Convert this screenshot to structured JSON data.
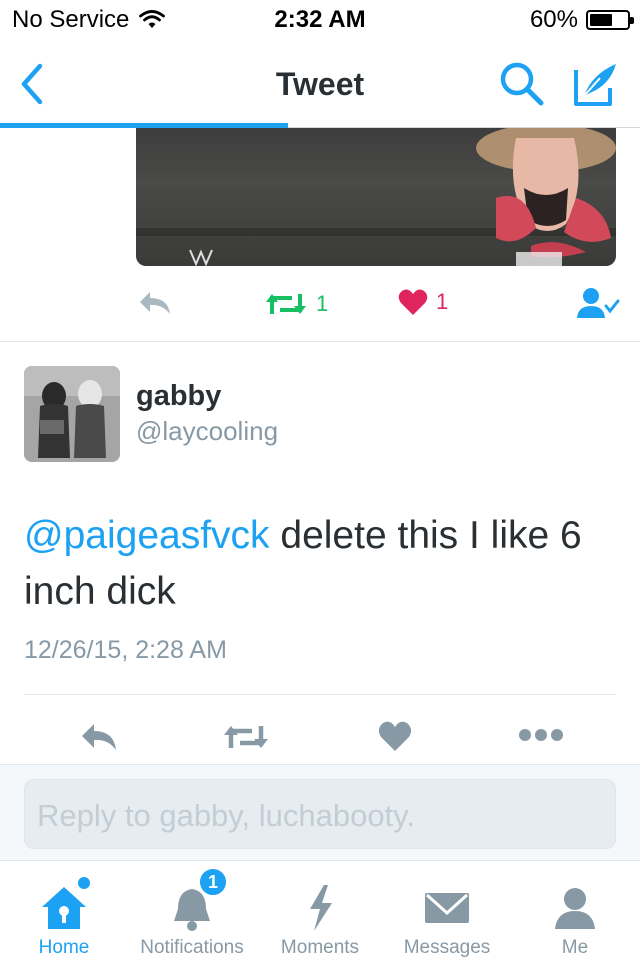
{
  "status_bar": {
    "carrier": "No Service",
    "time": "2:32 AM",
    "battery_percent": "60%",
    "battery_level": 0.6
  },
  "nav": {
    "title": "Tweet",
    "back_icon": "chevron-left-icon",
    "search_icon": "search-icon",
    "compose_icon": "compose-icon",
    "load_progress": 0.45
  },
  "parent_tweet": {
    "media_alt": "",
    "actions": {
      "retweet_count": "1",
      "like_count": "1"
    }
  },
  "tweet": {
    "name": "gabby",
    "handle": "@laycooling",
    "mention": "@paigeasfvck",
    "text": " delete this I like 6 inch dick",
    "timestamp": "12/26/15, 2:28 AM"
  },
  "reply": {
    "placeholder": "Reply to gabby, luchabooty."
  },
  "tabs": [
    {
      "label": "Home",
      "icon": "home-icon",
      "active": true
    },
    {
      "label": "Notifications",
      "icon": "bell-icon",
      "badge": "1"
    },
    {
      "label": "Moments",
      "icon": "lightning-icon"
    },
    {
      "label": "Messages",
      "icon": "envelope-icon"
    },
    {
      "label": "Me",
      "icon": "person-icon"
    }
  ],
  "colors": {
    "accent": "#1da1f2",
    "retweet": "#17bf63",
    "like": "#e0245e",
    "muted": "#8899a6"
  }
}
